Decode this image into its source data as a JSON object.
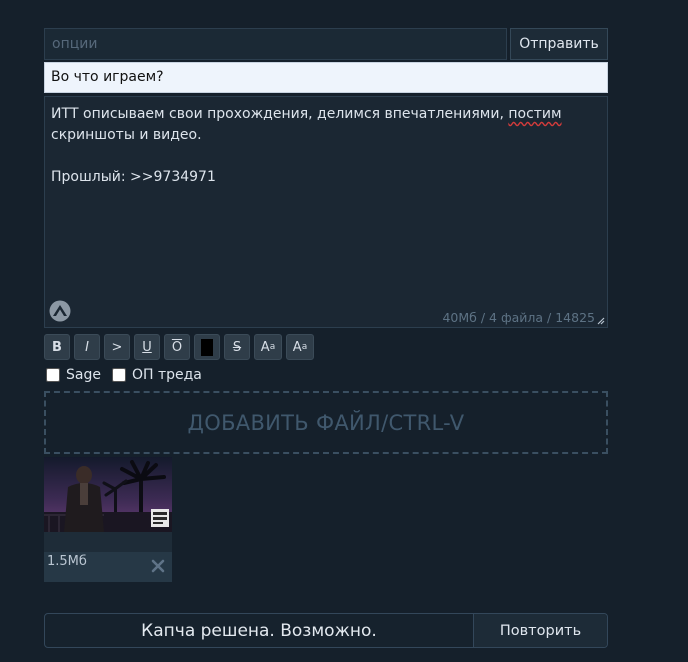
{
  "form": {
    "options_placeholder": "опции",
    "send_label": "Отправить",
    "subject": "Во что играем?",
    "message": {
      "line1_before": "ИТТ описываем свои прохождения, делимся впечатлениями, ",
      "line1_misspelled": "постим",
      "line1_after": " скриншоты и видео.",
      "blank": "",
      "previous": "Прошлый: >>9734971"
    },
    "counter": "40Мб / 4 файла / 14825"
  },
  "toolbar": {
    "bold": "B",
    "italic": "I",
    "quote": ">",
    "underline": "U",
    "overline": "O",
    "strike": "S",
    "sup_base": "A",
    "sup_mark": "a",
    "sub_base": "A",
    "sub_mark": "a"
  },
  "checkboxes": {
    "sage": "Sage",
    "op": "ОП треда"
  },
  "dropzone_label": "ДОБАВИТЬ ФАЙЛ/CTRL-V",
  "file": {
    "size": "1.5Мб"
  },
  "captcha": {
    "status": "Капча решена. Возможно.",
    "retry_label": "Повторить"
  },
  "icons": {
    "logo": "triangle-logo-icon",
    "remove": "close-icon",
    "resize": "resize-grip-icon"
  }
}
